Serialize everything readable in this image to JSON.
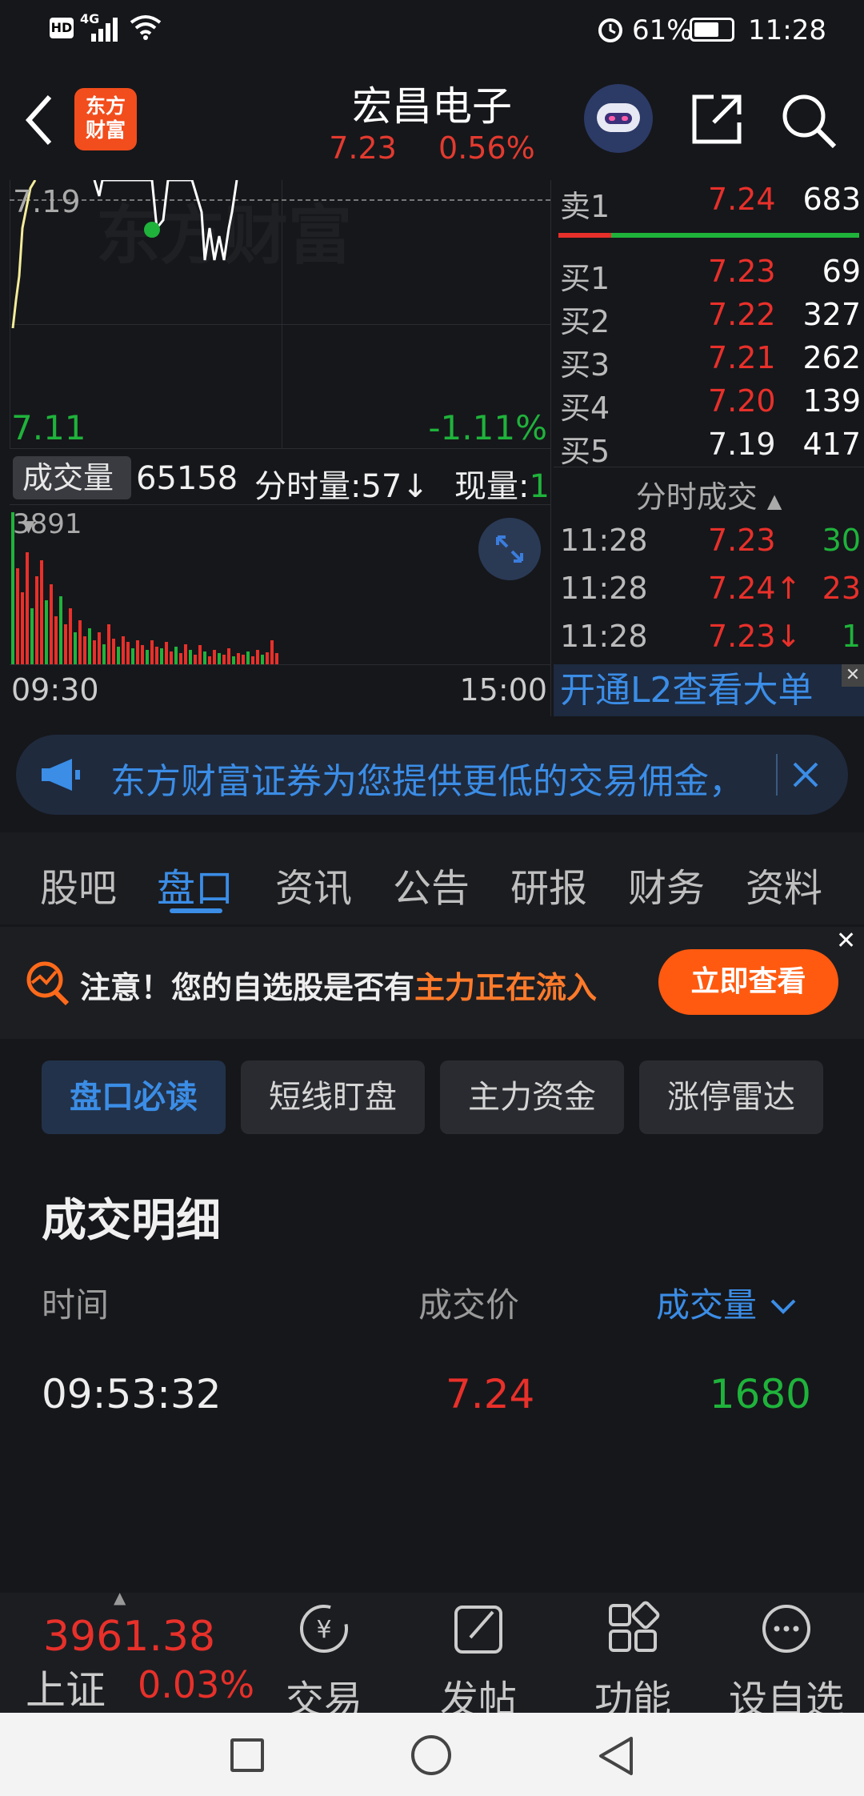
{
  "status_bar": {
    "network": "4G",
    "battery": "61%",
    "time": "11:28",
    "icons": [
      "hd-icon",
      "signal-icon",
      "wifi-icon",
      "alarm-icon",
      "battery-icon"
    ]
  },
  "header": {
    "title": "宏昌电子",
    "price": "7.23",
    "change_pct": "0.56%",
    "logo_line1": "东方",
    "logo_line2": "财富"
  },
  "chart": {
    "price_top": "7.19",
    "price_low": "7.11",
    "pct_low": "-1.11%",
    "volume_label": "成交量",
    "volume_value": "65158",
    "tick_vol_label": "分时量:57↓",
    "now_vol_label": "现量:",
    "now_vol_value": "1",
    "vol_max": "3891",
    "time_start": "09:30",
    "time_end": "15:00"
  },
  "orderbook": {
    "sell": [
      {
        "label": "卖1",
        "price": "7.24",
        "vol": "683"
      }
    ],
    "buy": [
      {
        "label": "买1",
        "price": "7.23",
        "vol": "69"
      },
      {
        "label": "买2",
        "price": "7.22",
        "vol": "327"
      },
      {
        "label": "买3",
        "price": "7.21",
        "vol": "262"
      },
      {
        "label": "买4",
        "price": "7.20",
        "vol": "139"
      },
      {
        "label": "买5",
        "price": "7.19",
        "vol": "417"
      }
    ],
    "ticks_title": "分时成交",
    "ticks": [
      {
        "time": "11:28",
        "price": "7.23",
        "vol": "30"
      },
      {
        "time": "11:28",
        "price": "7.24↑",
        "vol": "23"
      },
      {
        "time": "11:28",
        "price": "7.23↓",
        "vol": "1"
      }
    ],
    "l2_link": "开通L2查看大单"
  },
  "banner": {
    "text": "东方财富证券为您提供更低的交易佣金，"
  },
  "tabs": [
    "股吧",
    "盘口",
    "资讯",
    "公告",
    "研报",
    "财务",
    "资料"
  ],
  "active_tab": "盘口",
  "notice": {
    "prefix": "注意！您的自选股是否有",
    "highlight": "主力正在流入",
    "button": "立即查看"
  },
  "chips": [
    "盘口必读",
    "短线盯盘",
    "主力资金",
    "涨停雷达"
  ],
  "detail": {
    "title": "成交明细",
    "col_time": "时间",
    "col_price": "成交价",
    "col_vol": "成交量",
    "rows": [
      {
        "time": "09:53:32",
        "price": "7.24",
        "vol": "1680"
      }
    ]
  },
  "bottom_nav": {
    "index_value": "3961.38",
    "index_name": "上证",
    "index_change": "0.03%",
    "items": [
      "交易",
      "发帖",
      "功能",
      "设自选"
    ]
  },
  "colors": {
    "up": "#e8302a",
    "down": "#1fb33b",
    "accent": "#3b7ddd",
    "orange": "#ff6a1a"
  }
}
